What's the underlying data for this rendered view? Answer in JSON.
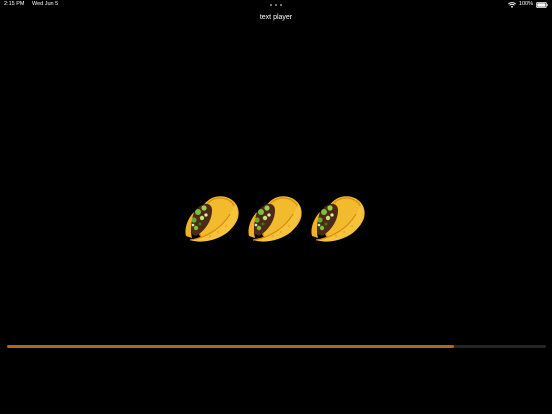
{
  "status_bar": {
    "time": "2:15 PM",
    "date": "Wed Jun 5",
    "battery_label": "100%",
    "wifi_icon": "wifi-icon",
    "battery_icon": "battery-icon"
  },
  "header": {
    "title": "text player"
  },
  "content": {
    "emojis": [
      {
        "char": "🌮",
        "name": "taco"
      },
      {
        "char": "🌮",
        "name": "taco"
      },
      {
        "char": "🌮",
        "name": "taco"
      }
    ]
  },
  "playback": {
    "progress": 0.83,
    "fill_color": "#b5661c",
    "track_color": "#262626"
  }
}
